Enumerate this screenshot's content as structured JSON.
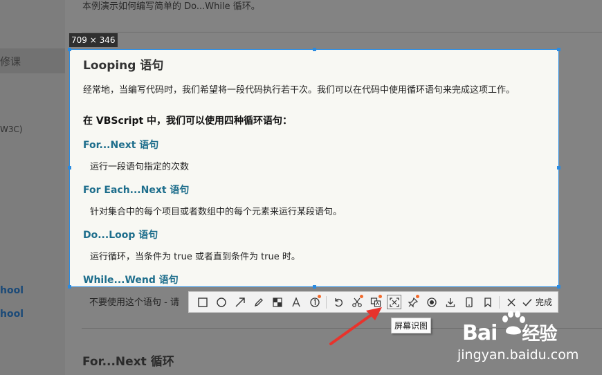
{
  "background": {
    "top_text": "本例演示如何编写简单的 Do...While 循环。",
    "nav_active_label": "修课",
    "nav_w3c_label": "W3C)",
    "nav_links": [
      "hool",
      "hool"
    ],
    "under_toolbar_text": "不要使用这个语句 - 请",
    "section_heading": "For...Next 循环"
  },
  "selection": {
    "size_label": "709 × 346",
    "title": "Looping 语句",
    "intro": "经常地，当编写代码时，我们希望将一段代码执行若干次。我们可以在代码中使用循环语句来完成这项工作。",
    "subheading": "在 VBScript 中，我们可以使用四种循环语句：",
    "loops": [
      {
        "title": "For...Next 语句",
        "desc": "运行一段语句指定的次数"
      },
      {
        "title": "For Each...Next 语句",
        "desc": "针对集合中的每个项目或者数组中的每个元素来运行某段语句。"
      },
      {
        "title": "Do...Loop 语句",
        "desc": "运行循环，当条件为 true 或者直到条件为 true 时。"
      },
      {
        "title": "While...Wend 语句",
        "desc": ""
      }
    ]
  },
  "toolbar": {
    "tools": [
      {
        "icon": "rectangle-icon"
      },
      {
        "icon": "ellipse-icon"
      },
      {
        "icon": "arrow-icon"
      },
      {
        "icon": "pencil-icon"
      },
      {
        "icon": "mosaic-icon"
      },
      {
        "icon": "text-icon"
      },
      {
        "icon": "number-icon"
      },
      {
        "icon": "undo-icon"
      },
      {
        "icon": "scissors-icon",
        "badge": true
      },
      {
        "icon": "translate-icon",
        "badge": true
      },
      {
        "icon": "screen-recognize-icon",
        "active": true
      },
      {
        "icon": "pin-icon",
        "badge": true
      },
      {
        "icon": "record-icon"
      },
      {
        "icon": "download-icon"
      },
      {
        "icon": "phone-icon"
      },
      {
        "icon": "bookmark-icon"
      },
      {
        "icon": "close-icon"
      }
    ],
    "done_label": "完成",
    "tooltip": "屏幕识图"
  },
  "colors": {
    "selection_border": "#2b8be0",
    "loop_title": "#1e6e8c",
    "badge": "#f26a2c",
    "arrow": "#e8332c"
  },
  "watermark": {
    "brand": "Bai",
    "brand_suffix": "经验",
    "url": "jingyan.baidu.com"
  }
}
